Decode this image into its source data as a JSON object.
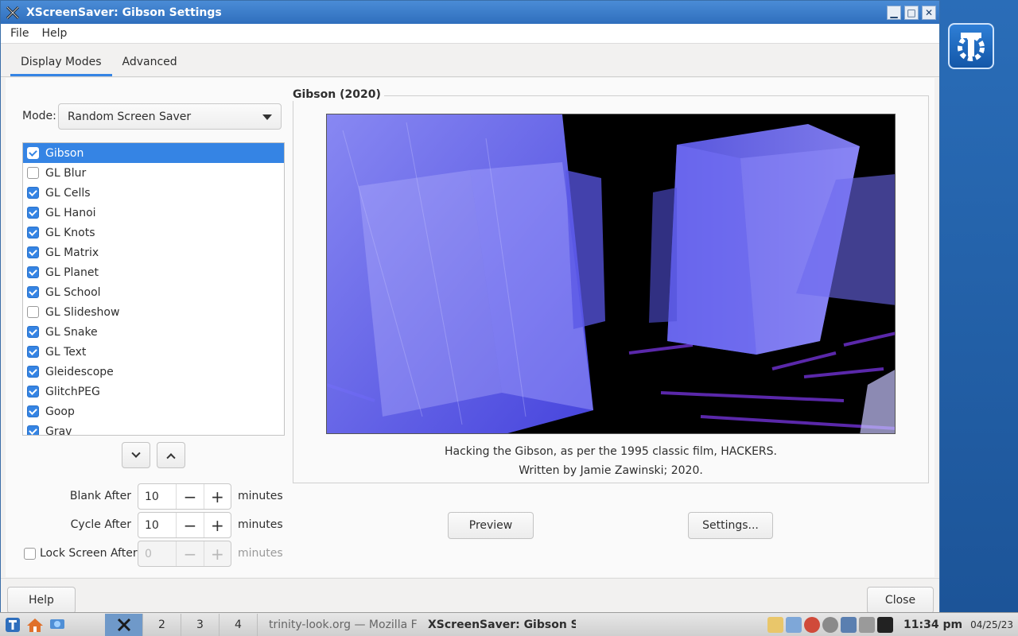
{
  "window": {
    "title": "XScreenSaver: Gibson Settings"
  },
  "menu": [
    "File",
    "Help"
  ],
  "tabs": [
    {
      "label": "Display Modes",
      "active": true
    },
    {
      "label": "Advanced",
      "active": false
    }
  ],
  "mode": {
    "label": "Mode:",
    "value": "Random Screen Saver"
  },
  "savers": [
    {
      "name": "Gibson",
      "checked": true,
      "selected": true
    },
    {
      "name": "GL Blur",
      "checked": false
    },
    {
      "name": "GL Cells",
      "checked": true
    },
    {
      "name": "GL Hanoi",
      "checked": true
    },
    {
      "name": "GL Knots",
      "checked": true
    },
    {
      "name": "GL Matrix",
      "checked": true
    },
    {
      "name": "GL Planet",
      "checked": true
    },
    {
      "name": "GL School",
      "checked": true
    },
    {
      "name": "GL Slideshow",
      "checked": false
    },
    {
      "name": "GL Snake",
      "checked": true
    },
    {
      "name": "GL Text",
      "checked": true
    },
    {
      "name": "Gleidescope",
      "checked": true
    },
    {
      "name": "GlitchPEG",
      "checked": true
    },
    {
      "name": "Goop",
      "checked": true
    },
    {
      "name": "Grav",
      "checked": true
    }
  ],
  "timers": {
    "blank": {
      "label": "Blank After",
      "value": "10",
      "unit": "minutes"
    },
    "cycle": {
      "label": "Cycle After",
      "value": "10",
      "unit": "minutes"
    },
    "lock": {
      "label": "Lock Screen After",
      "value": "0",
      "unit": "minutes",
      "checked": false
    }
  },
  "preview": {
    "frame_title": "Gibson (2020)",
    "description_line1": "Hacking the Gibson, as per the 1995 classic film, HACKERS.",
    "description_line2": "Written by Jamie Zawinski; 2020."
  },
  "buttons": {
    "preview": "Preview",
    "settings": "Settings...",
    "help": "Help",
    "close": "Close"
  },
  "taskbar": {
    "desktops": [
      "2",
      "3",
      "4"
    ],
    "tasks": [
      {
        "label": "trinity-look.org — Mozilla F",
        "active": false
      },
      {
        "label": "XScreenSaver: Gibson S",
        "active": true
      }
    ],
    "time": "11:34 pm",
    "date": "04/25/23"
  },
  "colors": {
    "accent": "#3584e4",
    "titlebar": "#2f6fbd"
  }
}
